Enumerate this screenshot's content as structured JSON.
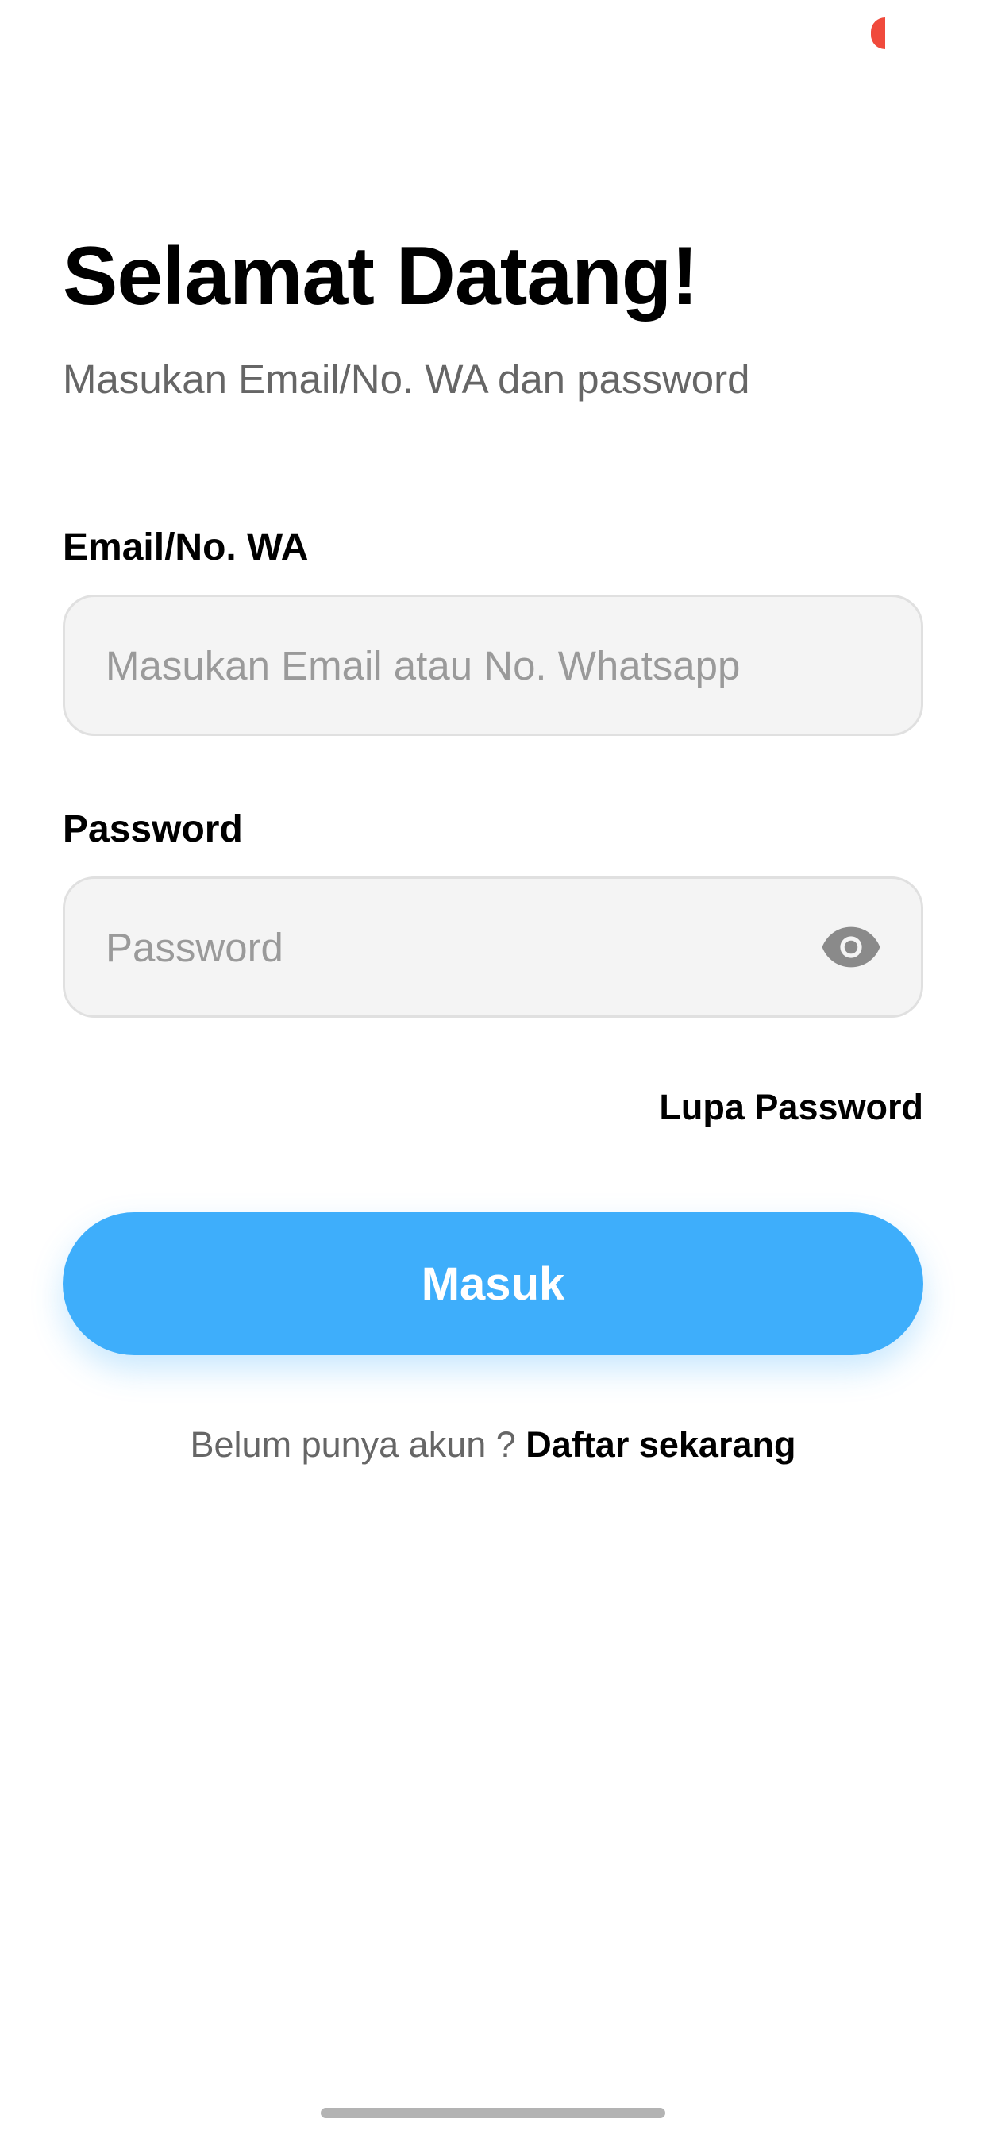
{
  "header": {
    "title": "Selamat Datang!",
    "subtitle": "Masukan Email/No. WA dan password"
  },
  "form": {
    "email_label": "Email/No. WA",
    "email_value": "",
    "email_placeholder": "Masukan Email atau No. Whatsapp",
    "password_label": "Password",
    "password_value": "",
    "password_placeholder": "Password",
    "password_toggle_icon": "eye-icon",
    "forgot_password": "Lupa Password",
    "submit_label": "Masuk"
  },
  "signup": {
    "prompt": "Belum punya akun ? ",
    "link": "Daftar sekarang"
  },
  "colors": {
    "primary": "#3eaefb",
    "status_dot": "#f04a3c",
    "input_background": "#f4f4f4",
    "input_border": "#e0e0e0",
    "muted_text": "#666666",
    "placeholder_text": "#9a9a9a"
  }
}
